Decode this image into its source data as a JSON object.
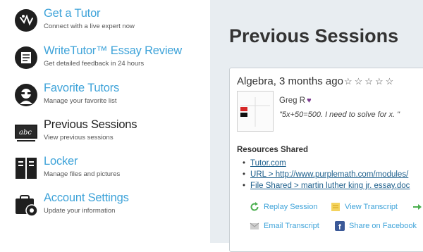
{
  "sidebar": {
    "items": [
      {
        "title": "Get a Tutor",
        "subtitle": "Connect with a live expert now",
        "icon": "tutor-icon"
      },
      {
        "title": "WriteTutor™ Essay Review",
        "subtitle": "Get detailed feedback in 24 hours",
        "icon": "essay-icon"
      },
      {
        "title": "Favorite Tutors",
        "subtitle": "Manage your favorite list",
        "icon": "favorite-tutor-icon"
      },
      {
        "title": "Previous Sessions",
        "subtitle": "View previous sessions",
        "icon": "chalkboard-icon",
        "active": true
      },
      {
        "title": "Locker",
        "subtitle": "Manage files and pictures",
        "icon": "locker-icon"
      },
      {
        "title": "Account Settings",
        "subtitle": "Update your information",
        "icon": "account-settings-icon"
      }
    ]
  },
  "main": {
    "title": "Previous Sessions",
    "session": {
      "heading": "Algebra, 3 months ago",
      "stars": "☆☆☆☆☆",
      "rating": 0,
      "tutor_name": "Greg R",
      "note": "\"5x+50=500. I need to solve for x. \"",
      "resources_heading": "Resources Shared",
      "resources": [
        "Tutor.com",
        "URL > http://www.purplemath.com/modules/",
        "File Shared > martin luther king jr. essay.doc"
      ],
      "actions": {
        "replay": "Replay Session",
        "transcript": "View Transcript",
        "email": "Email Transcript",
        "facebook": "Share on Facebook"
      }
    }
  },
  "colors": {
    "link": "#3ea3d9",
    "dark_link": "#1d5f8c",
    "panel_bg": "#e8edf1",
    "heart": "#7b3a8f"
  }
}
